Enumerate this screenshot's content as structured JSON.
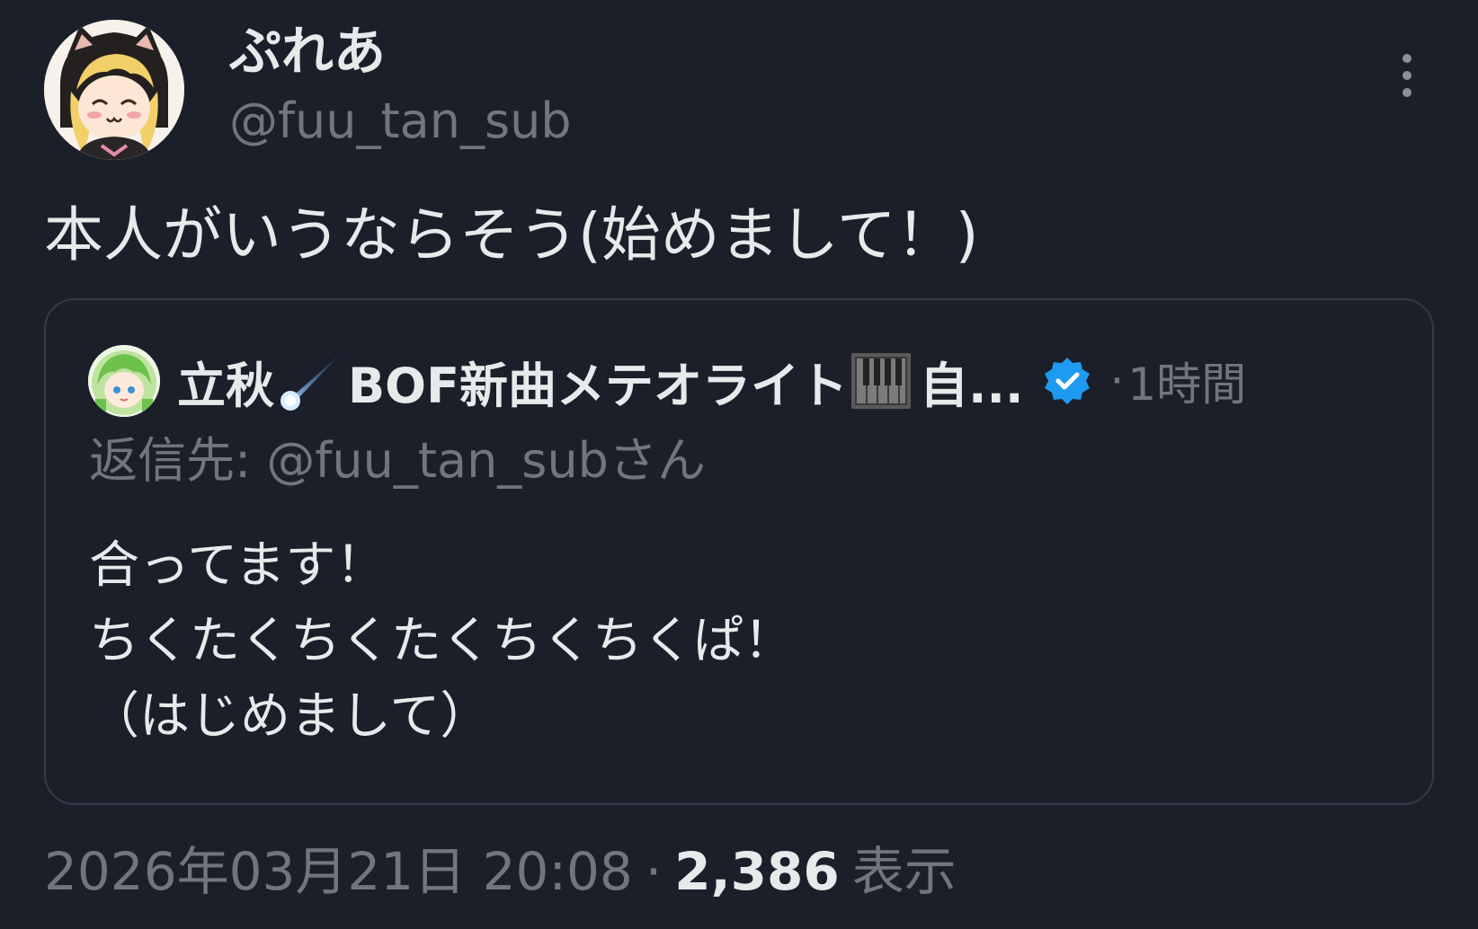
{
  "author": {
    "display_name": "ぷれあ",
    "handle": "@fuu_tan_sub"
  },
  "tweet": {
    "text": "本人がいうならそう(始めまして！)"
  },
  "quote": {
    "display_name": "立秋",
    "name_middle": "BOF新曲メテオライト",
    "name_end": "自...",
    "separator": "·",
    "time": "1時間",
    "reply_prefix": "返信先: ",
    "reply_handle": "@fuu_tan_subさん",
    "body_lines": [
      "合ってます！",
      "ちくたくちくたくちくちくぱ！",
      "（はじめまして）"
    ]
  },
  "meta": {
    "timestamp": "2026年03月21日 20:08",
    "separator": "·",
    "views_count": "2,386",
    "views_label": "表示"
  },
  "colors": {
    "background": "#1b1f2a",
    "text_primary": "#e7e9ea",
    "text_secondary": "#71767b",
    "verified": "#1d9bf0",
    "border": "#343a45"
  },
  "icons": {
    "more": "more-vertical-icon",
    "verified": "verified-badge-icon",
    "comet": "comet-emoji-icon",
    "piano": "piano-emoji-icon"
  }
}
